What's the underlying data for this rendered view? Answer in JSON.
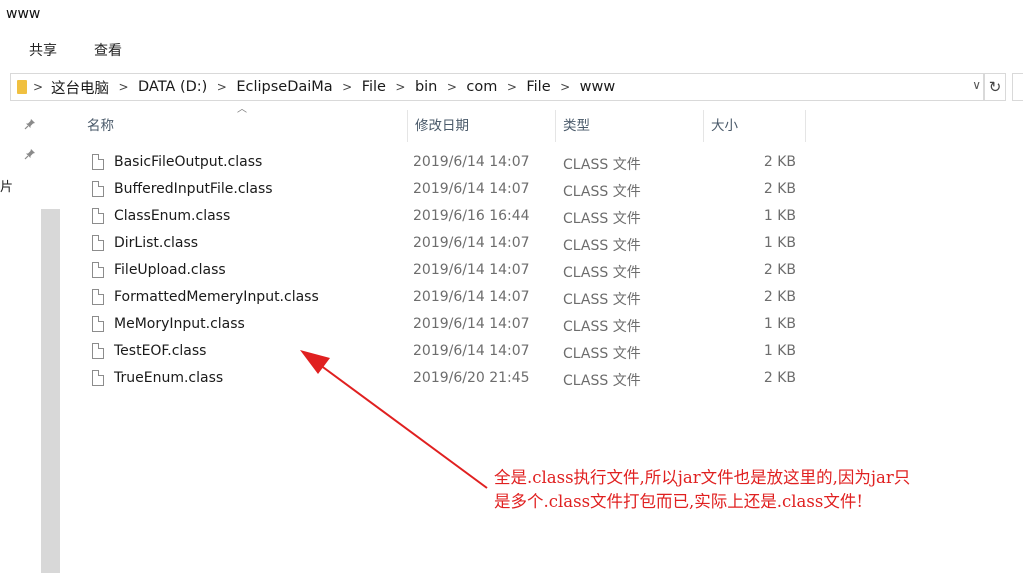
{
  "window": {
    "title": "www"
  },
  "ribbon": {
    "tabs": [
      "共享",
      "查看"
    ]
  },
  "address": {
    "crumbs": [
      "这台电脑",
      "DATA (D:)",
      "EclipseDaiMa",
      "File",
      "bin",
      "com",
      "File",
      "www"
    ],
    "separator": ">",
    "dropdown_glyph": "∨",
    "refresh_glyph": "↻"
  },
  "navpane": {
    "partial_char": "片"
  },
  "columns": {
    "name": "名称",
    "date": "修改日期",
    "type": "类型",
    "size": "大小"
  },
  "files": [
    {
      "name": "BasicFileOutput.class",
      "date": "2019/6/14 14:07",
      "type": "CLASS 文件",
      "size": "2 KB"
    },
    {
      "name": "BufferedInputFile.class",
      "date": "2019/6/14 14:07",
      "type": "CLASS 文件",
      "size": "2 KB"
    },
    {
      "name": "ClassEnum.class",
      "date": "2019/6/16 16:44",
      "type": "CLASS 文件",
      "size": "1 KB"
    },
    {
      "name": "DirList.class",
      "date": "2019/6/14 14:07",
      "type": "CLASS 文件",
      "size": "1 KB"
    },
    {
      "name": "FileUpload.class",
      "date": "2019/6/14 14:07",
      "type": "CLASS 文件",
      "size": "2 KB"
    },
    {
      "name": "FormattedMemeryInput.class",
      "date": "2019/6/14 14:07",
      "type": "CLASS 文件",
      "size": "2 KB"
    },
    {
      "name": "MeMoryInput.class",
      "date": "2019/6/14 14:07",
      "type": "CLASS 文件",
      "size": "1 KB"
    },
    {
      "name": "TestEOF.class",
      "date": "2019/6/14 14:07",
      "type": "CLASS 文件",
      "size": "1 KB"
    },
    {
      "name": "TrueEnum.class",
      "date": "2019/6/20 21:45",
      "type": "CLASS 文件",
      "size": "2 KB"
    }
  ],
  "annotation": {
    "line1": "全是.class执行文件,所以jar文件也是放这里的,因为jar只",
    "line2": "是多个.class文件打包而已,实际上还是.class文件!",
    "color": "#e02020"
  },
  "icons": [
    "folder-icon",
    "pin-icon",
    "file-icon",
    "sort-up-icon",
    "chevron-right-icon",
    "chevron-down-icon",
    "refresh-icon"
  ]
}
